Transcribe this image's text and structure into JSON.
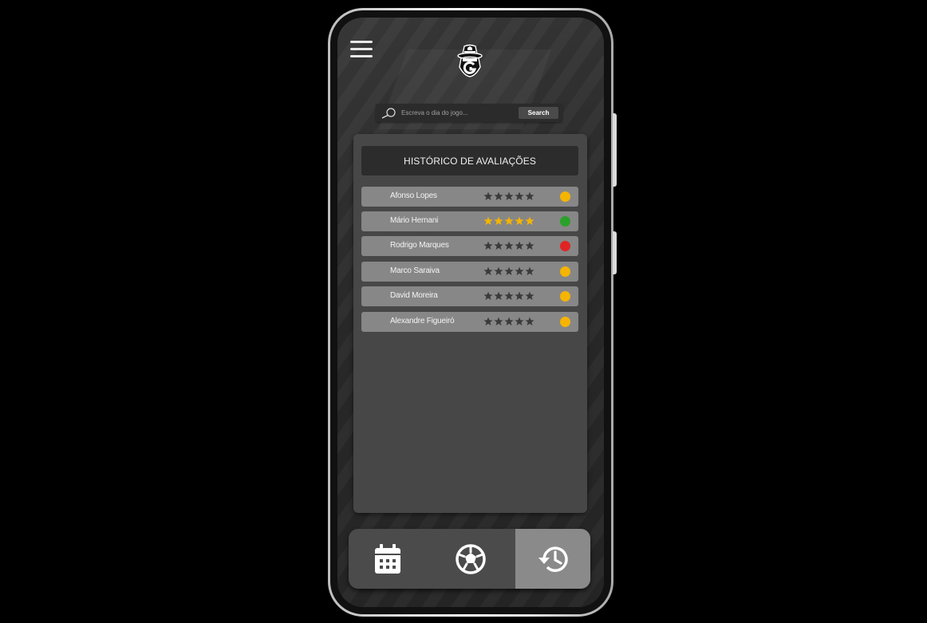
{
  "search": {
    "placeholder": "Escreva o dia do jogo...",
    "value": "",
    "button_label": "Search"
  },
  "history": {
    "title": "HISTÓRICO DE AVALIAÇÕES",
    "rows": [
      {
        "name": "Afonso Lopes",
        "stars_filled": 0,
        "status_color": "#f5b400"
      },
      {
        "name": "Mário Hernani",
        "stars_filled": 5,
        "status_color": "#2aa12a"
      },
      {
        "name": "Rodrigo Marques",
        "stars_filled": 0,
        "status_color": "#e02424"
      },
      {
        "name": "Marco Saraiva",
        "stars_filled": 0,
        "status_color": "#f5b400"
      },
      {
        "name": "David Moreira",
        "stars_filled": 0,
        "status_color": "#f5b400"
      },
      {
        "name": "Alexandre Figueiró",
        "stars_filled": 0,
        "status_color": "#f5b400"
      }
    ]
  },
  "nav": {
    "items": [
      {
        "icon": "calendar-icon",
        "active": false
      },
      {
        "icon": "soccer-ball-icon",
        "active": false
      },
      {
        "icon": "history-icon",
        "active": true
      }
    ]
  },
  "colors": {
    "star_filled": "#f5b400",
    "star_empty": "#3a3a3a",
    "status_yellow": "#f5b400",
    "status_green": "#2aa12a",
    "status_red": "#e02424"
  }
}
